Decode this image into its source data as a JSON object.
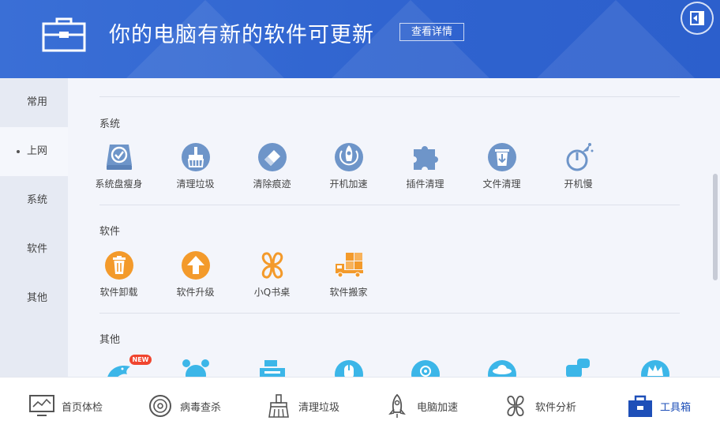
{
  "header": {
    "title": "你的电脑有新的软件可更新",
    "details_button": "查看详情"
  },
  "sidebar": {
    "items": [
      {
        "label": "常用"
      },
      {
        "label": "上网"
      },
      {
        "label": "系统"
      },
      {
        "label": "软件"
      },
      {
        "label": "其他"
      }
    ]
  },
  "sections": {
    "system": {
      "title": "系统",
      "tools": [
        {
          "label": "系统盘瘦身"
        },
        {
          "label": "清理垃圾"
        },
        {
          "label": "清除痕迹"
        },
        {
          "label": "开机加速"
        },
        {
          "label": "插件清理"
        },
        {
          "label": "文件清理"
        },
        {
          "label": "开机慢"
        }
      ]
    },
    "software": {
      "title": "软件",
      "tools": [
        {
          "label": "软件卸载"
        },
        {
          "label": "软件升级"
        },
        {
          "label": "小Q书桌"
        },
        {
          "label": "软件搬家"
        }
      ]
    },
    "other": {
      "title": "其他",
      "new_badge": "NEW"
    }
  },
  "bottom_nav": [
    {
      "label": "首页体检"
    },
    {
      "label": "病毒查杀"
    },
    {
      "label": "清理垃圾"
    },
    {
      "label": "电脑加速"
    },
    {
      "label": "软件分析"
    },
    {
      "label": "工具箱"
    }
  ],
  "colors": {
    "header_blue": "#2f63cf",
    "system_icon": "#6e95c9",
    "software_icon": "#f39a2b",
    "other_icon": "#3cb6e8",
    "active_nav": "#1e4fb8"
  }
}
